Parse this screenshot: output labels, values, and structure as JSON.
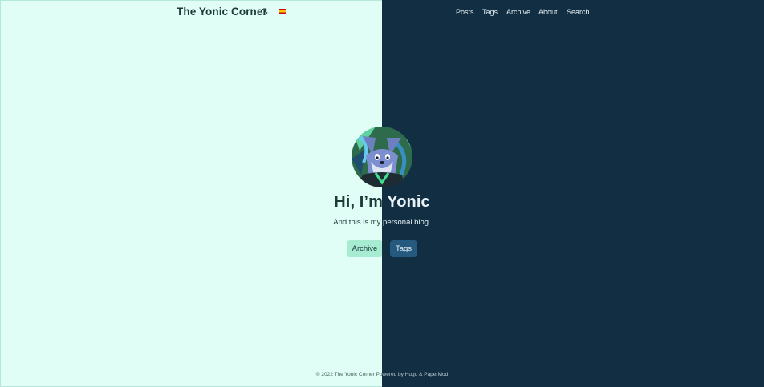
{
  "header": {
    "site_title": "The Yonic Corner",
    "theme_toggle_icon": "moon-icon",
    "language_icon": "spain-flag-icon",
    "nav": [
      "Posts",
      "Tags",
      "Archive",
      "About",
      "Search"
    ]
  },
  "profile": {
    "avatar_icon": "wolf-avatar",
    "heading": "Hi, I’m Yonic",
    "subtitle": "And this is my personal blog.",
    "buttons": [
      "Archive",
      "Tags"
    ]
  },
  "footer": {
    "copyright": "© 2022",
    "site_link": "The Yonic Corner",
    "powered_by": "Powered by",
    "hugo_link": "Hugo",
    "amp": "&",
    "papermod_link": "PaperMod"
  },
  "colors": {
    "light_bg": "#e0fdf6",
    "dark_bg": "#112e42",
    "archive_button": "#a8ebd3",
    "tags_button": "#26597e"
  }
}
